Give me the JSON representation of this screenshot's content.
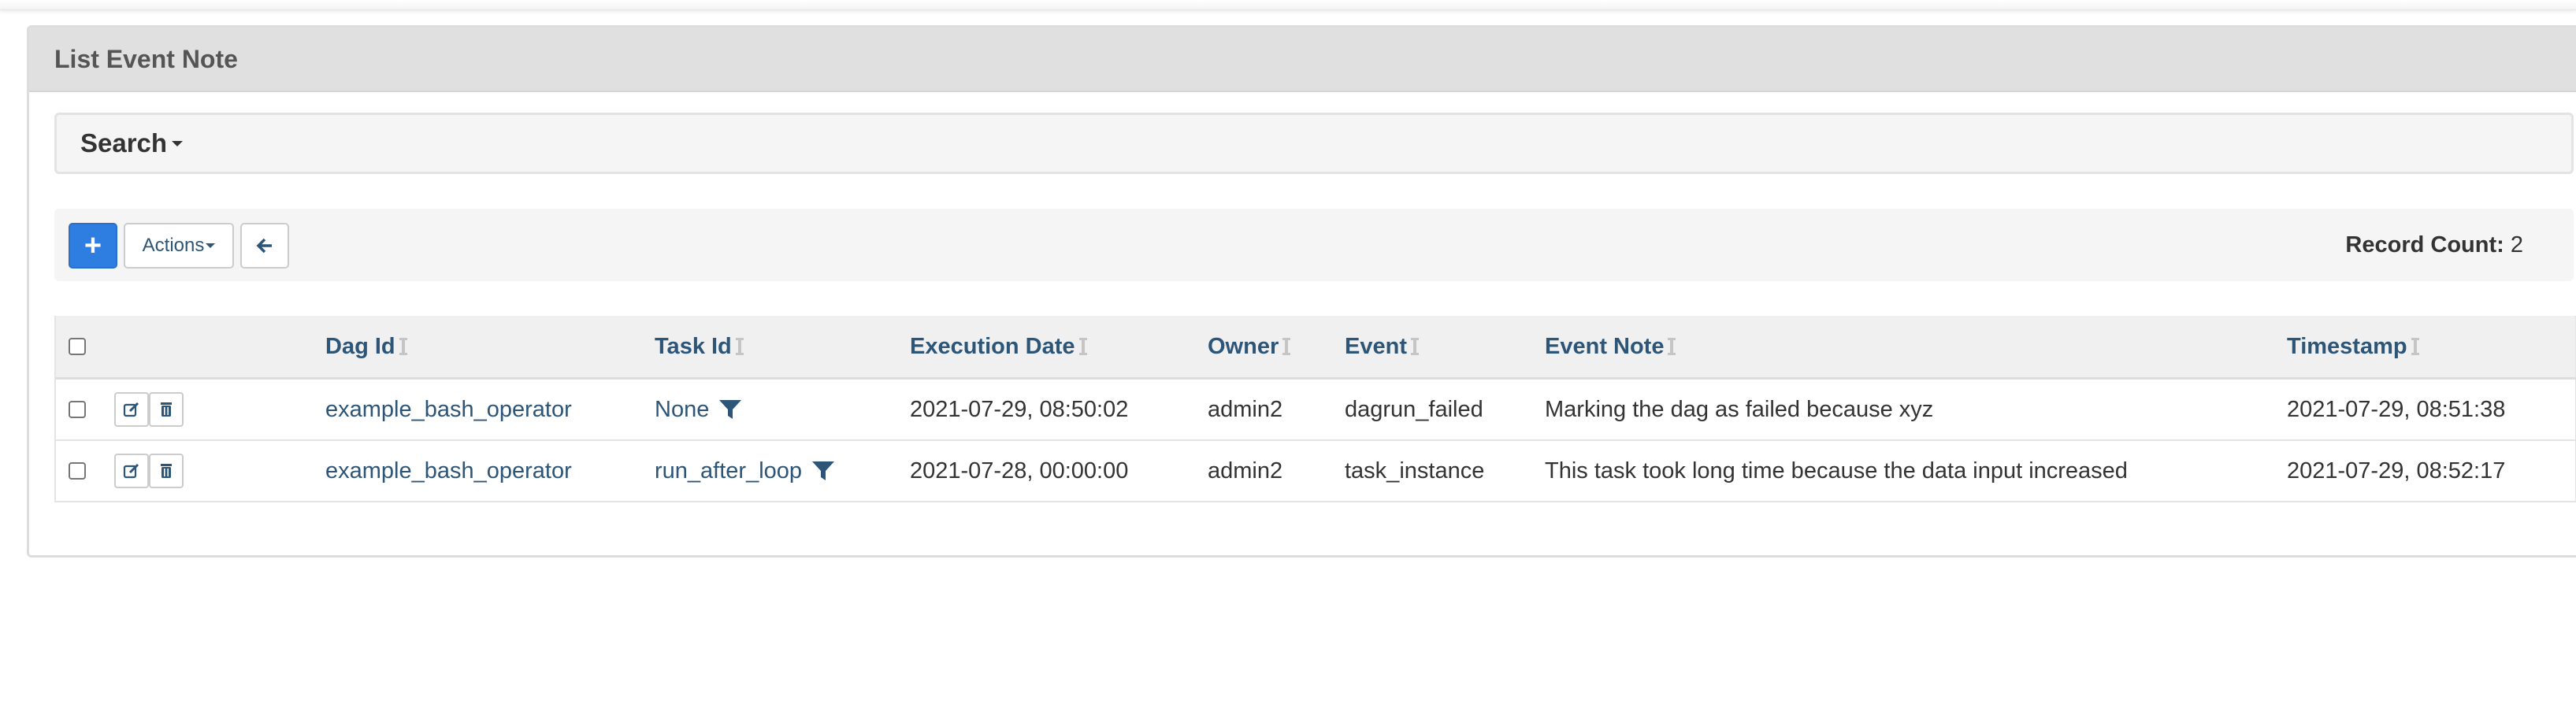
{
  "page": {
    "title": "List Event Note"
  },
  "search": {
    "label": "Search"
  },
  "toolbar": {
    "add_label": "+",
    "actions_label": "Actions",
    "record_count_label": "Record Count:",
    "record_count_value": "2"
  },
  "table": {
    "columns": [
      "Dag Id",
      "Task Id",
      "Execution Date",
      "Owner",
      "Event",
      "Event Note",
      "Timestamp"
    ],
    "rows": [
      {
        "dag_id": "example_bash_operator",
        "task_id": "None",
        "execution_date": "2021-07-29, 08:50:02",
        "owner": "admin2",
        "event": "dagrun_failed",
        "event_note": "Marking the dag as failed because xyz",
        "timestamp": "2021-07-29, 08:51:38"
      },
      {
        "dag_id": "example_bash_operator",
        "task_id": "run_after_loop",
        "execution_date": "2021-07-28, 00:00:00",
        "owner": "admin2",
        "event": "task_instance",
        "event_note": "This task took long time because the data input increased",
        "timestamp": "2021-07-29, 08:52:17"
      }
    ]
  },
  "icons": {
    "add": "plus-icon",
    "back": "arrow-left-icon",
    "edit": "edit-icon",
    "delete": "trash-icon",
    "filter": "filter-icon",
    "sort": "sort-icon"
  },
  "colors": {
    "primary": "#2e7de1",
    "link": "#2c5577",
    "panel_heading_bg": "#e0e0e0"
  }
}
